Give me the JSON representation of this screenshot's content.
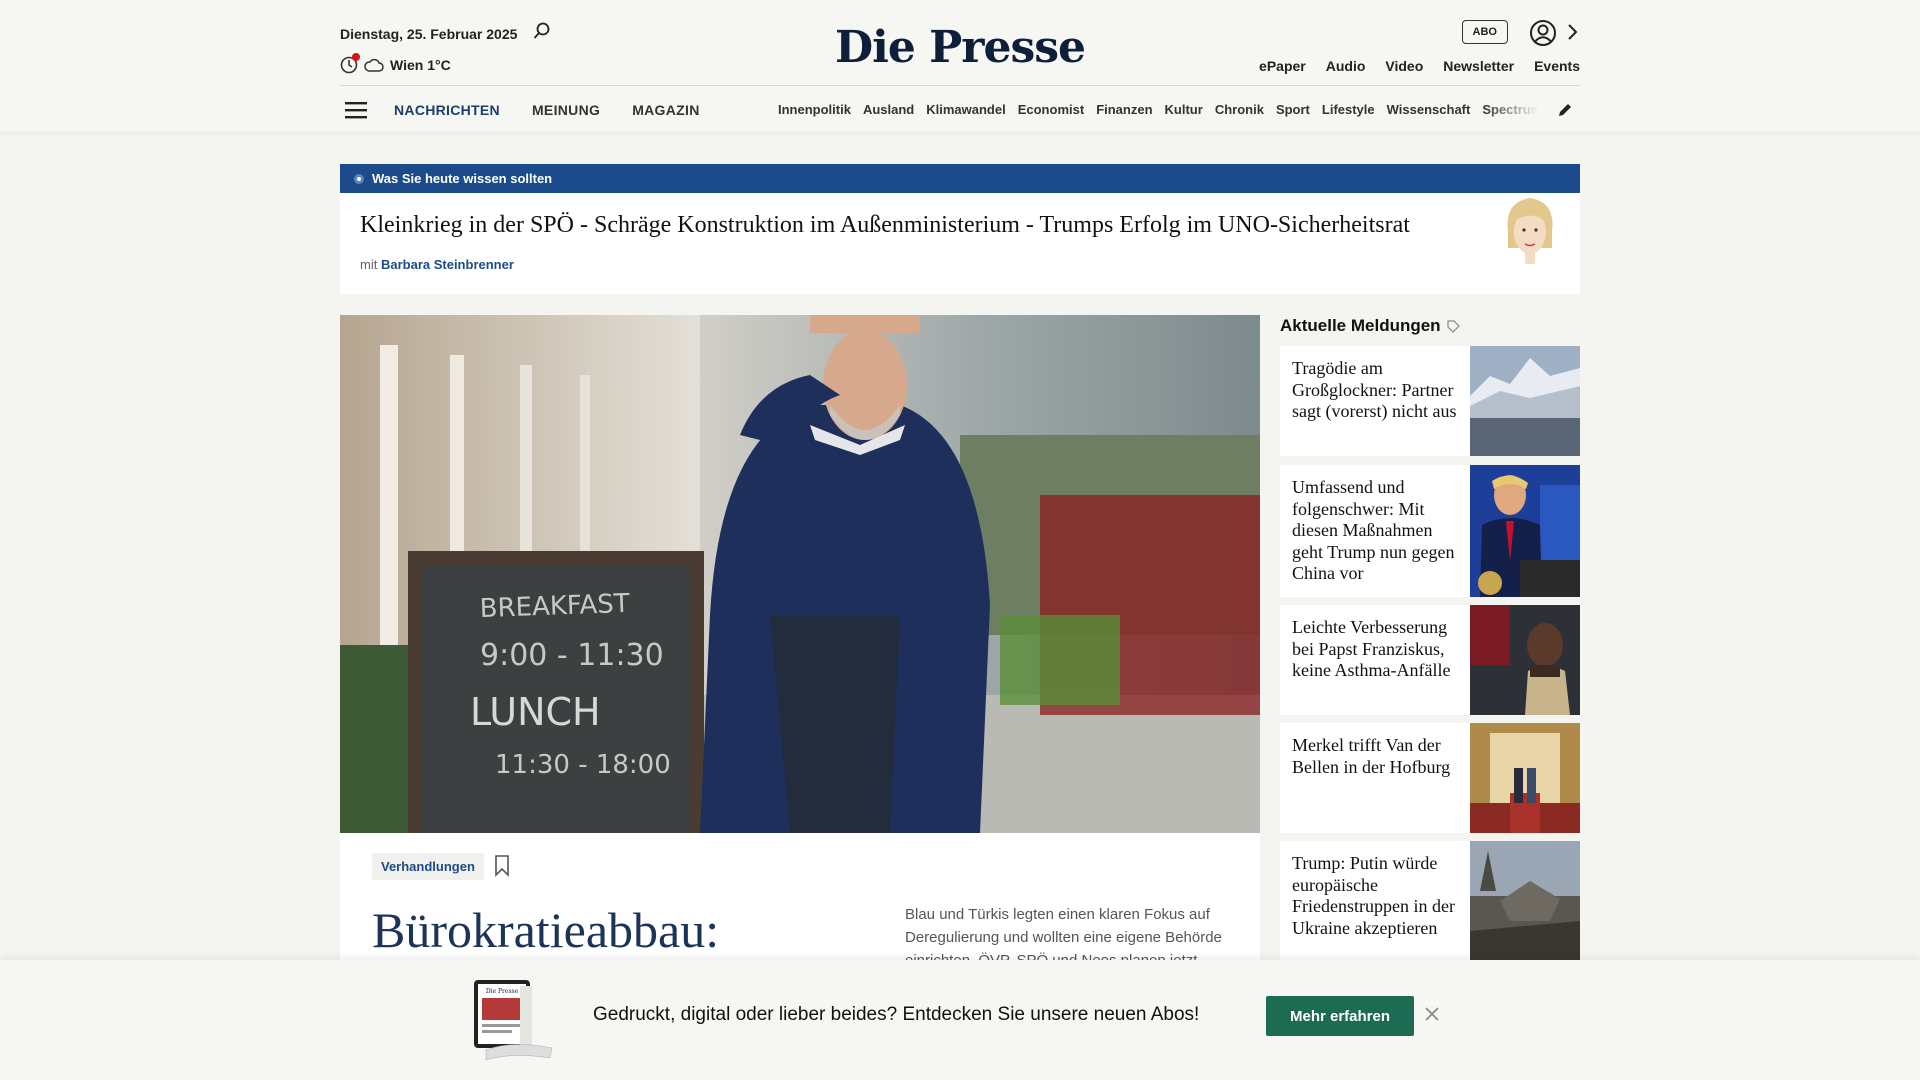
{
  "header": {
    "date": "Dienstag, 25. Februar 2025",
    "weather": "Wien 1°C",
    "logo": "Die Presse",
    "abo_label": "ABO",
    "top_links": [
      "ePaper",
      "Audio",
      "Video",
      "Newsletter",
      "Events"
    ],
    "main_nav": [
      "NACHRICHTEN",
      "MEINUNG",
      "MAGAZIN"
    ],
    "sub_nav": [
      "Innenpolitik",
      "Ausland",
      "Klimawandel",
      "Economist",
      "Finanzen",
      "Kultur",
      "Chronik",
      "Sport",
      "Lifestyle",
      "Wissenschaft",
      "Spectrum"
    ]
  },
  "briefing": {
    "label": "Was Sie heute wissen sollten",
    "title": "Kleinkrieg in der SPÖ - Schräge Konstruktion im Außenministerium - Trumps Erfolg im UNO-Sicherheitsrat",
    "mit": "mit",
    "author": "Barbara Steinbrenner"
  },
  "hero": {
    "tag": "Verhandlungen",
    "headline": "Bürokratieabbau:",
    "teaser": "Blau und Türkis legten einen klaren Fokus auf Deregulierung und wollten eine eigene Behörde einrichten. ÖVP, SPÖ und Neos planen jetzt",
    "board_lines": [
      "BREAKFAST",
      "9:00 - 11:30",
      "LUNCH",
      "11:30 - 18:00"
    ]
  },
  "sidebar": {
    "title": "Aktuelle Meldungen",
    "items": [
      {
        "title": "Tragödie am Großglockner: Partner sagt (vorerst) nicht aus"
      },
      {
        "title": "Umfassend und folgenschwer: Mit diesen Maßnahmen geht Trump nun gegen China vor"
      },
      {
        "title": "Leichte Verbesserung bei Papst Franziskus, keine Asthma-Anfälle"
      },
      {
        "title": "Merkel trifft Van der Bellen in der Hofburg"
      },
      {
        "title": "Trump: Putin würde europäische Friedenstruppen in der Ukraine akzeptieren"
      }
    ]
  },
  "banner": {
    "text": "Gedruckt, digital oder lieber beides? Entdecken Sie unsere neuen Abos!",
    "button": "Mehr erfahren",
    "mini_logo": "Die Presse"
  },
  "colors": {
    "accent_blue": "#1b4b8a",
    "cta_green": "#1e6b54",
    "notification_red": "#d7141a"
  }
}
